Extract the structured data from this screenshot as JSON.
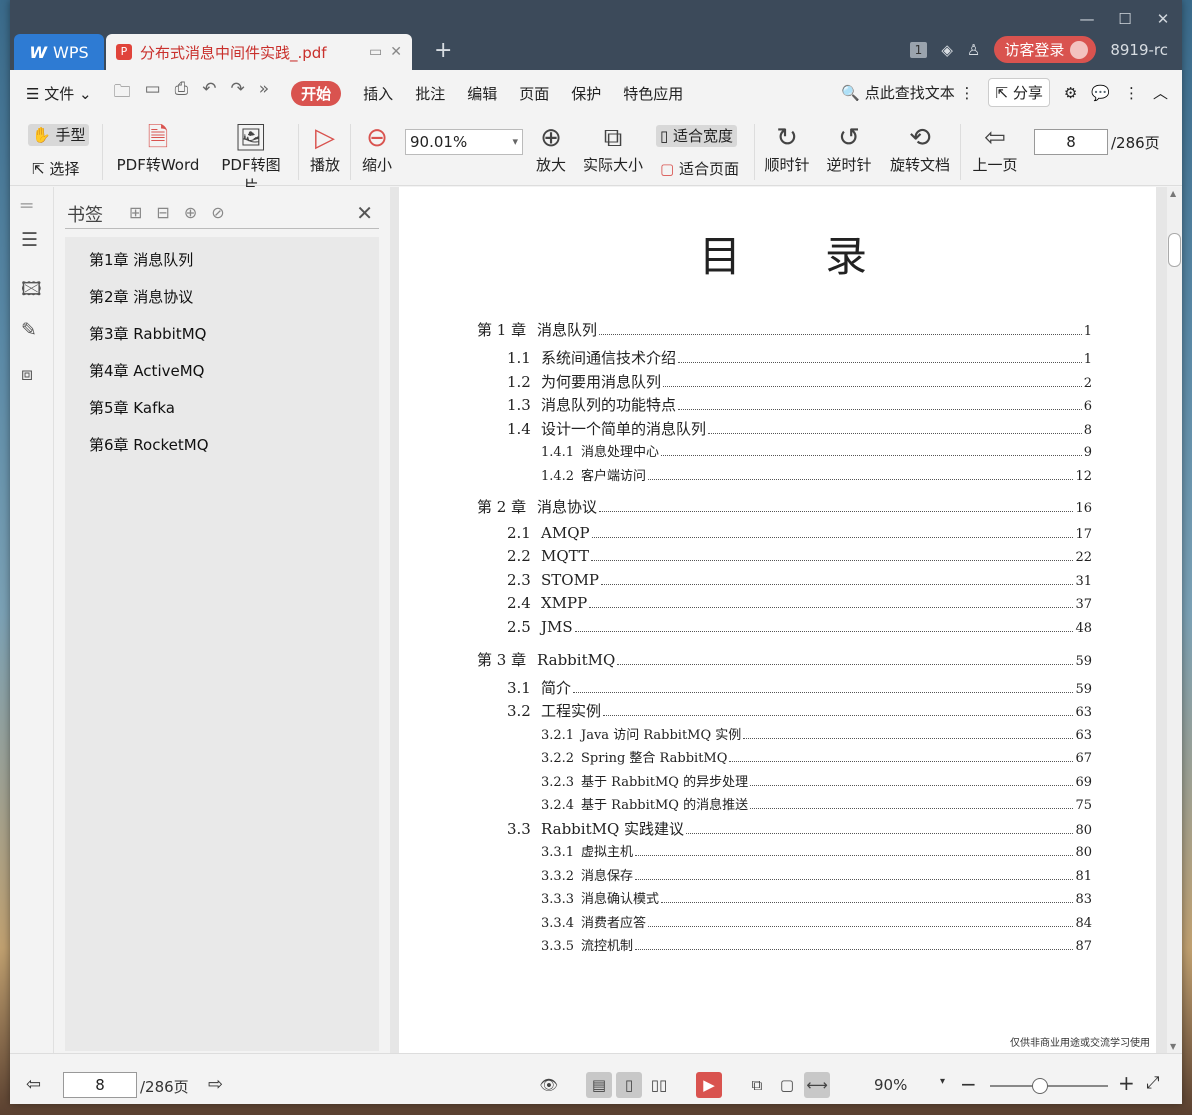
{
  "titlebar": {
    "app_tab": "WPS",
    "doc_tab": "分布式消息中间件实践_.pdf",
    "page_badge": "1",
    "login": "访客登录",
    "version": "8919-rc"
  },
  "menu": {
    "file": "文件",
    "tabs": [
      "开始",
      "插入",
      "批注",
      "编辑",
      "页面",
      "保护",
      "特色应用"
    ],
    "search": "点此查找文本",
    "share": "分享"
  },
  "toolbar": {
    "hand": "手型",
    "select": "选择",
    "pdf_to_word": "PDF转Word",
    "pdf_to_image": "PDF转图片",
    "play": "播放",
    "zoom_out": "缩小",
    "zoom_value": "90.01%",
    "zoom_in": "放大",
    "actual_size": "实际大小",
    "fit_width": "适合宽度",
    "fit_page": "适合页面",
    "rotate_cw": "顺时针",
    "rotate_ccw": "逆时针",
    "rotate_doc": "旋转文档",
    "prev_page": "上一页",
    "page_current": "8",
    "page_total": "/286页"
  },
  "bookmarks": {
    "title": "书签",
    "items": [
      "第1章 消息队列",
      "第2章 消息协议",
      "第3章 RabbitMQ",
      "第4章 ActiveMQ",
      "第5章 Kafka",
      "第6章 RocketMQ"
    ]
  },
  "document": {
    "toc_title": "目录",
    "entries": [
      {
        "level": "chap",
        "num": "第 1 章",
        "text": "消息队列",
        "page": "1"
      },
      {
        "level": "sect",
        "num": "1.1",
        "text": "系统间通信技术介绍",
        "page": "1"
      },
      {
        "level": "sect",
        "num": "1.2",
        "text": "为何要用消息队列",
        "page": "2"
      },
      {
        "level": "sect",
        "num": "1.3",
        "text": "消息队列的功能特点",
        "page": "6"
      },
      {
        "level": "sect",
        "num": "1.4",
        "text": "设计一个简单的消息队列",
        "page": "8"
      },
      {
        "level": "sub",
        "num": "1.4.1",
        "text": "消息处理中心",
        "page": "9"
      },
      {
        "level": "sub",
        "num": "1.4.2",
        "text": "客户端访问",
        "page": "12"
      },
      {
        "level": "chap",
        "num": "第 2 章",
        "text": "消息协议",
        "page": "16"
      },
      {
        "level": "sect",
        "num": "2.1",
        "text": "AMQP",
        "page": "17"
      },
      {
        "level": "sect",
        "num": "2.2",
        "text": "MQTT",
        "page": "22"
      },
      {
        "level": "sect",
        "num": "2.3",
        "text": "STOMP",
        "page": "31"
      },
      {
        "level": "sect",
        "num": "2.4",
        "text": "XMPP",
        "page": "37"
      },
      {
        "level": "sect",
        "num": "2.5",
        "text": "JMS",
        "page": "48"
      },
      {
        "level": "chap",
        "num": "第 3 章",
        "text": "RabbitMQ",
        "page": "59"
      },
      {
        "level": "sect",
        "num": "3.1",
        "text": "简介",
        "page": "59"
      },
      {
        "level": "sect",
        "num": "3.2",
        "text": "工程实例",
        "page": "63"
      },
      {
        "level": "sub",
        "num": "3.2.1",
        "text": "Java 访问 RabbitMQ 实例",
        "page": "63"
      },
      {
        "level": "sub",
        "num": "3.2.2",
        "text": "Spring 整合 RabbitMQ",
        "page": "67"
      },
      {
        "level": "sub",
        "num": "3.2.3",
        "text": "基于 RabbitMQ 的异步处理",
        "page": "69"
      },
      {
        "level": "sub",
        "num": "3.2.4",
        "text": "基于 RabbitMQ 的消息推送",
        "page": "75"
      },
      {
        "level": "sect",
        "num": "3.3",
        "text": "RabbitMQ 实践建议",
        "page": "80"
      },
      {
        "level": "sub",
        "num": "3.3.1",
        "text": "虚拟主机",
        "page": "80"
      },
      {
        "level": "sub",
        "num": "3.3.2",
        "text": "消息保存",
        "page": "81"
      },
      {
        "level": "sub",
        "num": "3.3.3",
        "text": "消息确认模式",
        "page": "83"
      },
      {
        "level": "sub",
        "num": "3.3.4",
        "text": "消费者应答",
        "page": "84"
      },
      {
        "level": "sub",
        "num": "3.3.5",
        "text": "流控机制",
        "page": "87"
      }
    ],
    "footer_note": "仅供非商业用途或交流学习使用"
  },
  "statusbar": {
    "page_current": "8",
    "page_total": "/286页",
    "zoom": "90%"
  }
}
